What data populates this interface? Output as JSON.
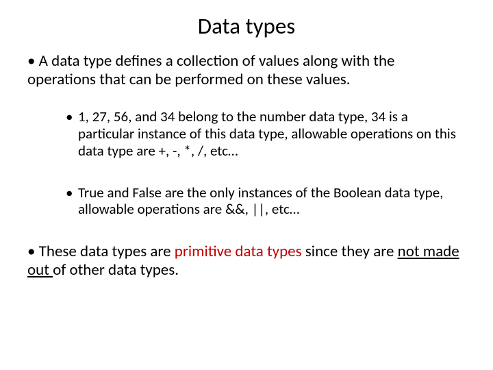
{
  "title": "Data types",
  "p1": {
    "t1": "A data type defines a collection of values along with the operations that can be performed on these values."
  },
  "p2": {
    "t1": "1, 27, 56, and 34 belong to the number data type, 34 is a particular instance of this data type, allowable operations on this data type are +, -, *, /, etc…"
  },
  "p3": {
    "t1": "True and False are the only instances of the Boolean data type, allowable operations are &&, ||, etc…"
  },
  "p4": {
    "t1": "These data types are ",
    "t2": "primitive data types",
    "t3": " since they are ",
    "t4": "not made out ",
    "t5": "of other data types."
  }
}
